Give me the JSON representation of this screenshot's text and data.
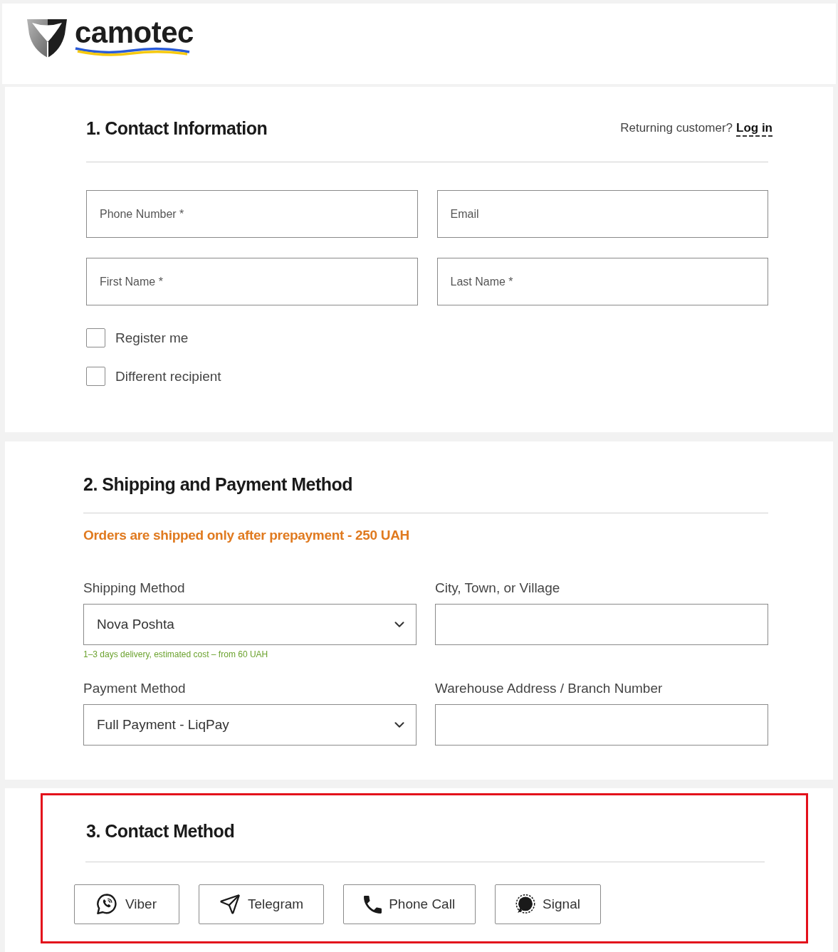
{
  "header": {
    "logo_text": "camotec"
  },
  "contact_information": {
    "title": "1. Contact Information",
    "returning_prompt": "Returning customer?",
    "login_link": "Log in",
    "fields": [
      {
        "placeholder": "Phone Number *"
      },
      {
        "placeholder": "Email"
      },
      {
        "placeholder": "First Name *"
      },
      {
        "placeholder": "Last Name *"
      }
    ],
    "checkboxes": [
      {
        "label": "Register me",
        "checked": false
      },
      {
        "label": "Different recipient",
        "checked": false
      }
    ]
  },
  "shipping_payment": {
    "title": "2. Shipping and Payment Method",
    "notice": "Orders are shipped only after prepayment - 250 UAH",
    "fields": [
      {
        "kind": "select",
        "label": "Shipping Method",
        "value": "Nova Poshta",
        "hint": "1–3 days delivery, estimated cost – from 60 UAH"
      },
      {
        "kind": "text",
        "label": "City, Town, or Village"
      },
      {
        "kind": "select",
        "label": "Payment Method",
        "value": "Full Payment - LiqPay"
      },
      {
        "kind": "text",
        "label": "Warehouse Address / Branch Number"
      }
    ]
  },
  "contact_method": {
    "title": "3. Contact Method",
    "highlighted": true,
    "options": [
      {
        "kind": "viber",
        "label": "Viber",
        "selected": false
      },
      {
        "kind": "telegram",
        "label": "Telegram",
        "selected": false
      },
      {
        "kind": "phone",
        "label": "Phone Call",
        "selected": false
      },
      {
        "kind": "signal",
        "label": "Signal",
        "selected": false
      }
    ]
  }
}
